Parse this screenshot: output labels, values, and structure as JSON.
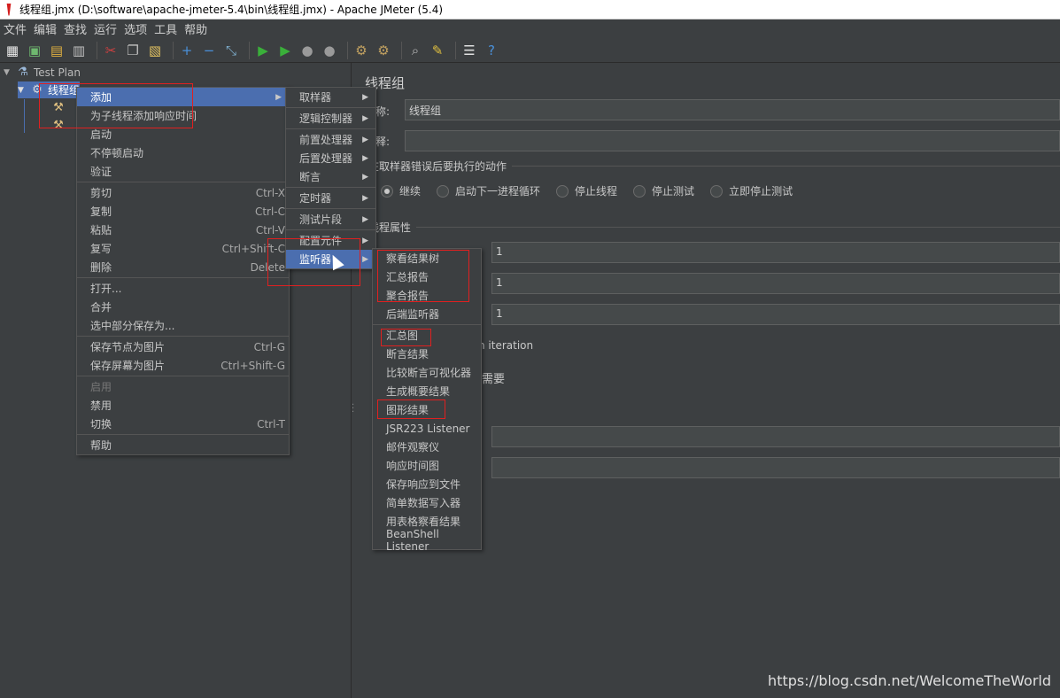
{
  "window": {
    "title": "线程组.jmx (D:\\software\\apache-jmeter-5.4\\bin\\线程组.jmx) - Apache JMeter (5.4)"
  },
  "menubar": [
    "文件",
    "编辑",
    "查找",
    "运行",
    "选项",
    "工具",
    "帮助"
  ],
  "toolbar": [
    {
      "name": "new-icon",
      "glyph": "▦"
    },
    {
      "name": "templates-icon",
      "glyph": "▣"
    },
    {
      "name": "open-icon",
      "glyph": "▤"
    },
    {
      "name": "save-icon",
      "glyph": "▥"
    },
    {
      "name": "cut-icon",
      "glyph": "✂"
    },
    {
      "name": "copy-icon",
      "glyph": "❐"
    },
    {
      "name": "paste-icon",
      "glyph": "▧"
    },
    {
      "name": "expand-icon",
      "glyph": "+"
    },
    {
      "name": "collapse-icon",
      "glyph": "−"
    },
    {
      "name": "toggle-icon",
      "glyph": "⤡"
    },
    {
      "name": "start-icon",
      "glyph": "▶"
    },
    {
      "name": "start-no-pause-icon",
      "glyph": "▶"
    },
    {
      "name": "stop-icon",
      "glyph": "●"
    },
    {
      "name": "shutdown-icon",
      "glyph": "●"
    },
    {
      "name": "clear-icon",
      "glyph": "⚙"
    },
    {
      "name": "clear-all-icon",
      "glyph": "⚙"
    },
    {
      "name": "search-icon",
      "glyph": "⌕"
    },
    {
      "name": "reset-search-icon",
      "glyph": "✎"
    },
    {
      "name": "function-helper-icon",
      "glyph": "☰"
    },
    {
      "name": "help-icon",
      "glyph": "?"
    }
  ],
  "tree": {
    "test_plan": "Test Plan",
    "thread_group": "线程组"
  },
  "right_panel": {
    "title": "线程组",
    "name_label": "称:",
    "name_value": "线程组",
    "comment_label": "释:",
    "error_action_label": "在取样器错误后要执行的动作",
    "radios": [
      "继续",
      "启动下一进程循环",
      "停止线程",
      "停止测试",
      "立即停止测试"
    ],
    "thread_props_label": "线程属性",
    "threads_value": "1",
    "rampup_value": "1",
    "loop_value": "1",
    "same_user_text": "h iteration",
    "delay_text": "需要"
  },
  "context_menu": {
    "items": [
      {
        "label": "添加",
        "submenu": true,
        "active": true
      },
      {
        "label": "为子线程添加响应时间"
      },
      {
        "label": "启动"
      },
      {
        "label": "不停顿启动"
      },
      {
        "label": "验证"
      },
      {
        "sep": true
      },
      {
        "label": "剪切",
        "shortcut": "Ctrl-X"
      },
      {
        "label": "复制",
        "shortcut": "Ctrl-C"
      },
      {
        "label": "粘贴",
        "shortcut": "Ctrl-V"
      },
      {
        "label": "复写",
        "shortcut": "Ctrl+Shift-C"
      },
      {
        "label": "删除",
        "shortcut": "Delete"
      },
      {
        "sep": true
      },
      {
        "label": "打开..."
      },
      {
        "label": "合并"
      },
      {
        "label": "选中部分保存为..."
      },
      {
        "sep": true
      },
      {
        "label": "保存节点为图片",
        "shortcut": "Ctrl-G"
      },
      {
        "label": "保存屏幕为图片",
        "shortcut": "Ctrl+Shift-G"
      },
      {
        "sep": true
      },
      {
        "label": "启用",
        "disabled": true
      },
      {
        "label": "禁用"
      },
      {
        "label": "切换",
        "shortcut": "Ctrl-T"
      },
      {
        "sep": true
      },
      {
        "label": "帮助"
      }
    ]
  },
  "add_submenu": {
    "items": [
      {
        "label": "取样器",
        "submenu": true
      },
      {
        "sep": true
      },
      {
        "label": "逻辑控制器",
        "submenu": true
      },
      {
        "sep": true
      },
      {
        "label": "前置处理器",
        "submenu": true
      },
      {
        "label": "后置处理器",
        "submenu": true
      },
      {
        "label": "断言",
        "submenu": true
      },
      {
        "sep": true
      },
      {
        "label": "定时器",
        "submenu": true
      },
      {
        "sep": true
      },
      {
        "label": "测试片段",
        "submenu": true
      },
      {
        "sep": true
      },
      {
        "label": "配置元件",
        "submenu": true
      },
      {
        "label": "监听器",
        "submenu": true,
        "active": true
      }
    ]
  },
  "listener_submenu": {
    "items": [
      {
        "label": "察看结果树"
      },
      {
        "label": "汇总报告"
      },
      {
        "label": "聚合报告"
      },
      {
        "label": "后端监听器"
      },
      {
        "sep": true
      },
      {
        "label": "汇总图"
      },
      {
        "label": "断言结果"
      },
      {
        "label": "比较断言可视化器"
      },
      {
        "label": "生成概要结果"
      },
      {
        "label": "图形结果"
      },
      {
        "label": "JSR223 Listener"
      },
      {
        "label": "邮件观察仪"
      },
      {
        "label": "响应时间图"
      },
      {
        "label": "保存响应到文件"
      },
      {
        "label": "简单数据写入器"
      },
      {
        "label": "用表格察看结果"
      },
      {
        "label": "BeanShell Listener"
      }
    ]
  },
  "watermark": "https://blog.csdn.net/WelcomeTheWorld",
  "colors": {
    "bg": "#3c3f41",
    "highlight": "#4b6eaf",
    "annotation": "#e02020"
  }
}
